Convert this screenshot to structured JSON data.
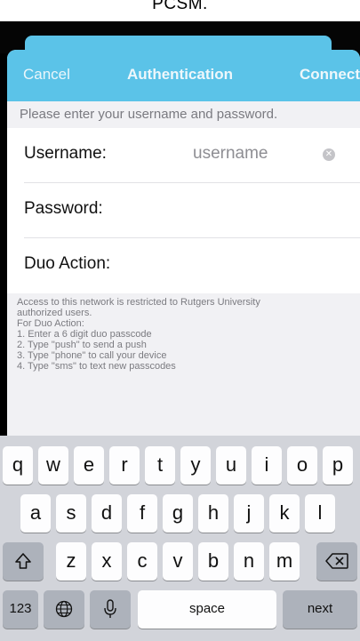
{
  "status_bar": {
    "text": "PCSM."
  },
  "dialog": {
    "cancel_label": "Cancel",
    "title": "Authentication",
    "connect_label": "Connect",
    "prompt": "Please enter your username and password.",
    "fields": [
      {
        "label": "Username:",
        "placeholder": "username"
      },
      {
        "label": "Password:",
        "placeholder": ""
      },
      {
        "label": "Duo Action:",
        "placeholder": ""
      }
    ],
    "help_text": "Access to this network is restricted to Rutgers University\nauthorized users.\nFor Duo Action:\n1. Enter a 6 digit duo passcode\n2. Type \"push\" to send a push\n3. Type \"phone\" to call your device\n4. Type \"sms\" to text new passcodes"
  },
  "keyboard": {
    "row1": [
      "q",
      "w",
      "e",
      "r",
      "t",
      "y",
      "u",
      "i",
      "o",
      "p"
    ],
    "row2": [
      "a",
      "s",
      "d",
      "f",
      "g",
      "h",
      "j",
      "k",
      "l"
    ],
    "row3": [
      "z",
      "x",
      "c",
      "v",
      "b",
      "n",
      "m"
    ],
    "numbers_label": "123",
    "space_label": "space",
    "next_label": "next",
    "icons": {
      "shift": "shift-icon",
      "backspace": "backspace-icon",
      "globe": "globe-icon",
      "mic": "microphone-icon"
    }
  },
  "colors": {
    "accent": "#5bc3e8",
    "keyboard_bg": "#d2d4da"
  }
}
